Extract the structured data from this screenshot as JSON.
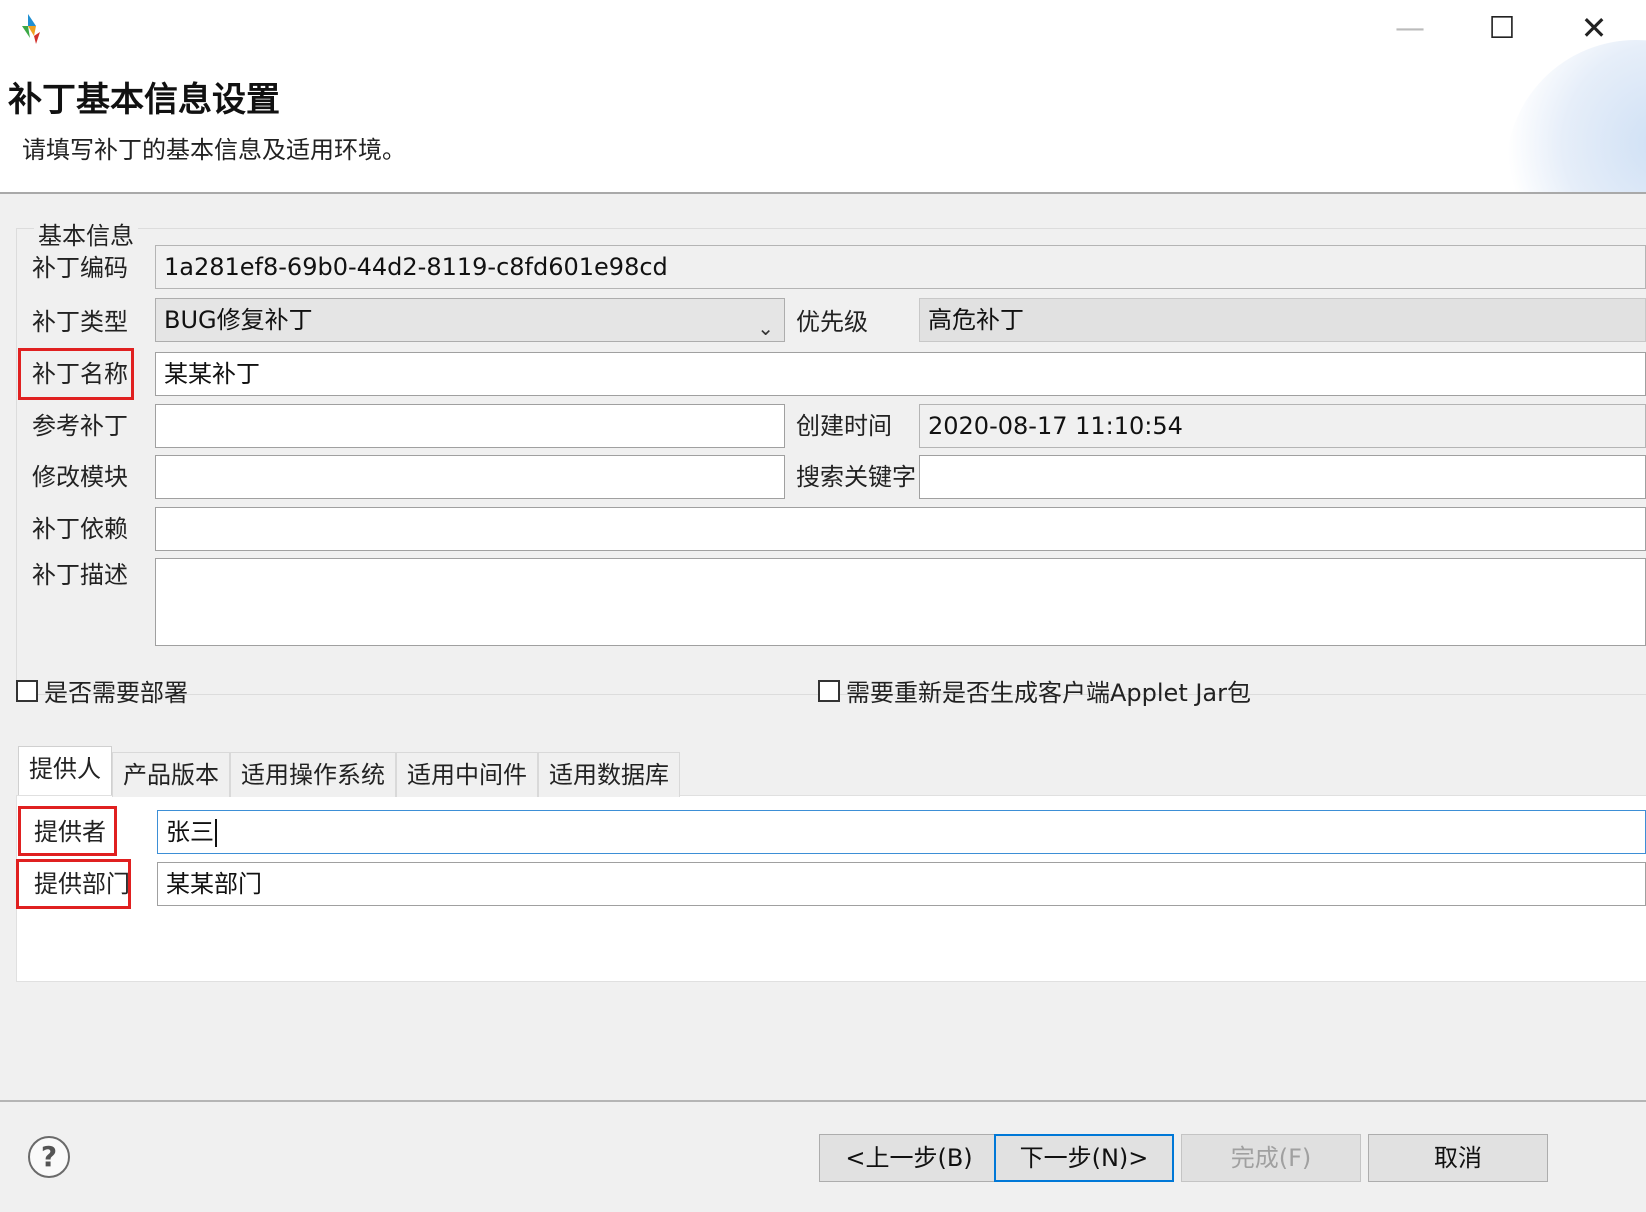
{
  "window": {
    "minimize_glyph": "—",
    "maximize_glyph": "☐",
    "close_glyph": "✕"
  },
  "header": {
    "title": "补丁基本信息设置",
    "subtitle": "请填写补丁的基本信息及适用环境。"
  },
  "basic_info": {
    "group_label": "基本信息",
    "patch_code_label": "补丁编码",
    "patch_code_value": "1a281ef8-69b0-44d2-8119-c8fd601e98cd",
    "patch_type_label": "补丁类型",
    "patch_type_value": "BUG修复补丁",
    "priority_label": "优先级",
    "priority_value": "高危补丁",
    "patch_name_label": "补丁名称",
    "patch_name_value": "某某补丁",
    "ref_patch_label": "参考补丁",
    "ref_patch_value": "",
    "created_time_label": "创建时间",
    "created_time_value": "2020-08-17 11:10:54",
    "modify_module_label": "修改模块",
    "modify_module_value": "",
    "search_keyword_label": "搜索关键字",
    "search_keyword_value": "",
    "dependency_label": "补丁依赖",
    "dependency_value": "",
    "description_label": "补丁描述",
    "description_value": ""
  },
  "options": {
    "need_deploy_label": "是否需要部署",
    "regen_applet_label": "需要重新是否生成客户端Applet Jar包"
  },
  "tabs": [
    "提供人",
    "产品版本",
    "适用操作系统",
    "适用中间件",
    "适用数据库"
  ],
  "provider": {
    "provider_label": "提供者",
    "provider_value": "张三",
    "department_label": "提供部门",
    "department_value": "某某部门"
  },
  "footer": {
    "help_glyph": "?",
    "back_label": "<上一步(B)",
    "next_label": "下一步(N)>",
    "finish_label": "完成(F)",
    "cancel_label": "取消"
  },
  "colors": {
    "highlight_box": "#e02020",
    "default_button_border": "#0078d7"
  }
}
